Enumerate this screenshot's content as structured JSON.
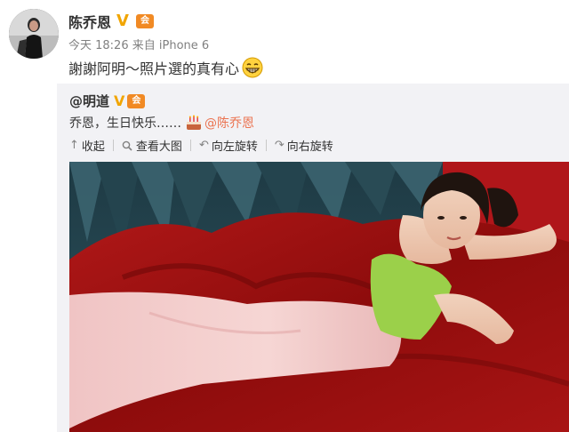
{
  "post": {
    "author": "陈乔恩",
    "verified_mark": "V",
    "vip_mark": "会",
    "time": "今天 18:26",
    "source_prefix": "来自",
    "source": "iPhone 6",
    "text": "謝謝阿明～照片選的真有心",
    "emoji": "grin-emoji"
  },
  "repost": {
    "author": "@明道",
    "verified_mark": "V",
    "vip_mark": "会",
    "text": "乔恩，生日快乐……",
    "emoji": "cake-emoji",
    "mention": "@陈乔恩",
    "toolbar": {
      "collapse": "收起",
      "collapse_icon": "↑",
      "view_large": "查看大图",
      "view_large_icon": "magnifier-icon",
      "rotate_left": "向左旋转",
      "rotate_left_icon": "↶",
      "rotate_right": "向右旋转",
      "rotate_right_icon": "↷"
    }
  },
  "colors": {
    "name": "#333333",
    "meta": "#808080",
    "mention": "#eb7350",
    "verified": "#f1a500",
    "repost_bg": "#f2f2f5"
  }
}
